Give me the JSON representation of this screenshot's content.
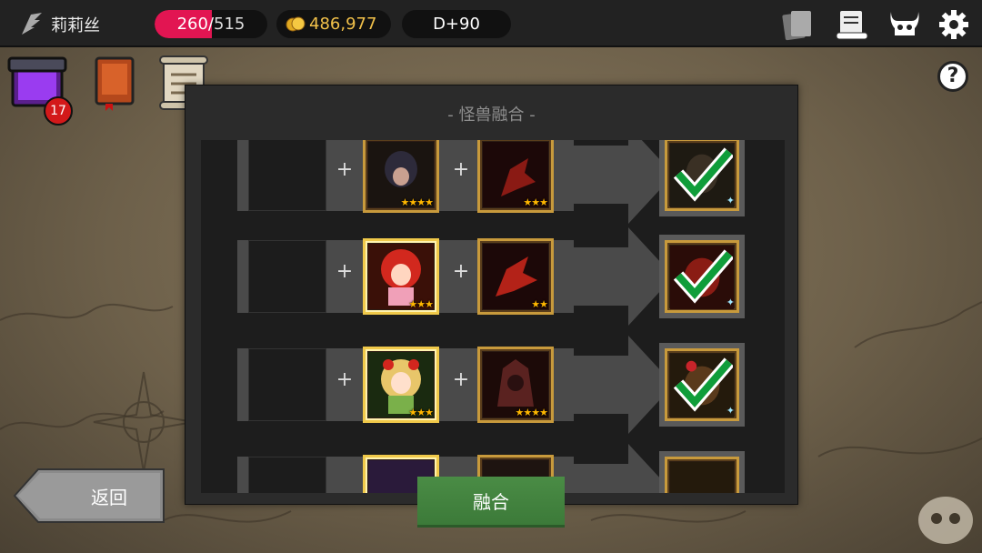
{
  "topbar": {
    "player_name": "莉莉丝",
    "hp_current": "260",
    "hp_separator": "/",
    "hp_max": "515",
    "hp_fraction": 0.505,
    "gold": "486,977",
    "day": "D+90",
    "icons": [
      "cards-icon",
      "scroll-icon",
      "demon-skull-icon",
      "gear-icon"
    ]
  },
  "side": {
    "chest_badge": "17",
    "icons": [
      "purple-chest-icon",
      "red-book-icon",
      "map-scroll-icon",
      "help-icon"
    ],
    "help_label": "?"
  },
  "dialog": {
    "title": "- 怪兽融合 -",
    "rows": [
      {
        "plus1": "+",
        "plus2": "+",
        "card1_stars": "★★★★",
        "card2_stars": "★★★",
        "result_mark": "✦"
      },
      {
        "plus1": "+",
        "plus2": "+",
        "card1_stars": "★★★",
        "card2_stars": "★★",
        "result_mark": "✦"
      },
      {
        "plus1": "+",
        "plus2": "+",
        "card1_stars": "★★★",
        "card2_stars": "★★★★",
        "result_mark": "✦"
      },
      {
        "plus1": "+",
        "plus2": "+",
        "card1_stars": "",
        "card2_stars": "",
        "result_mark": ""
      }
    ]
  },
  "buttons": {
    "fuse": "融合",
    "back": "返回"
  },
  "colors": {
    "hp": "#e21552",
    "gold": "#f2c14a",
    "fuse_button": "#4a8c45",
    "check": "#0f9d3a"
  }
}
